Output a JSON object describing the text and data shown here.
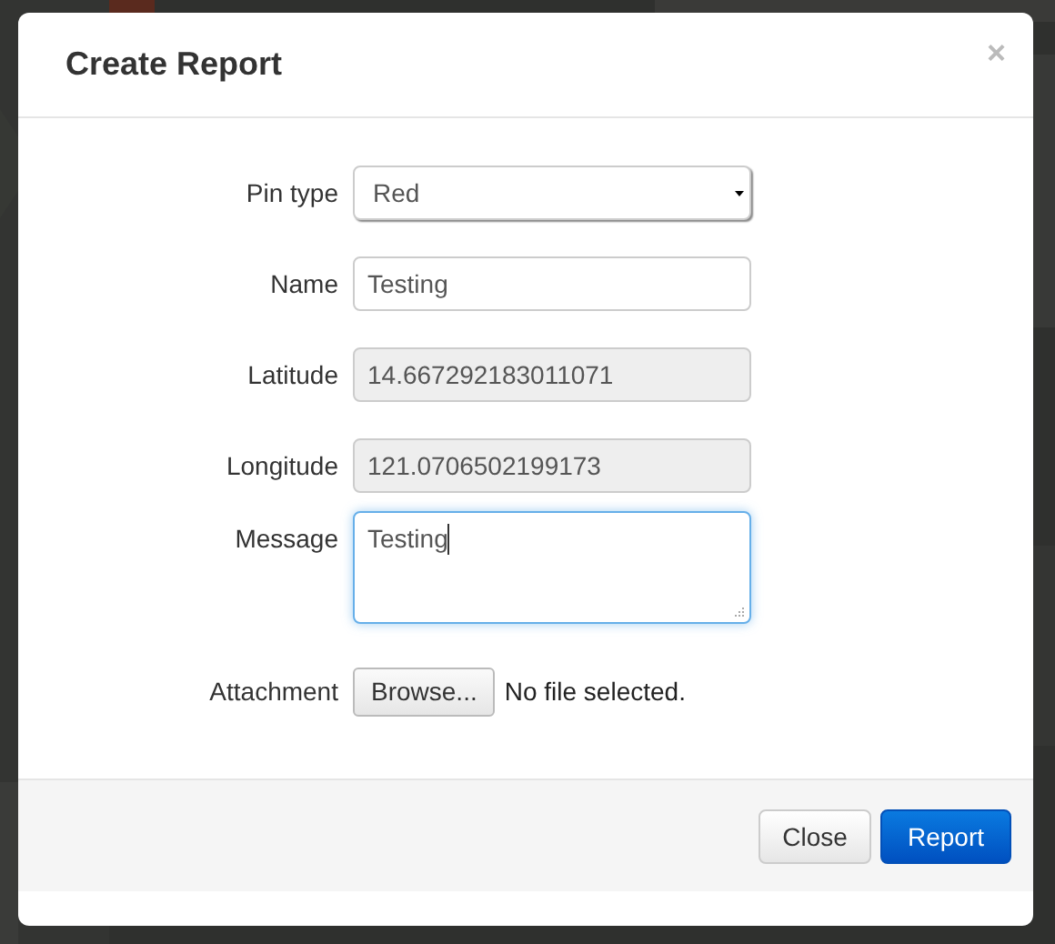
{
  "dialog": {
    "title": "Create Report",
    "close": "×"
  },
  "fields": [
    {
      "kind": "select",
      "label": "Pin type",
      "value": "Red",
      "focused": false
    },
    {
      "kind": "text",
      "label": "Name",
      "value": "Testing",
      "focused": false
    },
    {
      "kind": "readonly",
      "label": "Latitude",
      "value": "14.667292183011071",
      "focused": false
    },
    {
      "kind": "readonly",
      "label": "Longitude",
      "value": "121.0706502199173",
      "focused": false
    },
    {
      "kind": "textarea",
      "label": "Message",
      "value": "Testing",
      "focused": true
    },
    {
      "kind": "file",
      "label": "Attachment",
      "button": "Browse...",
      "status": "No file selected."
    }
  ],
  "buttons": [
    {
      "kind": "default",
      "label": "Close"
    },
    {
      "kind": "primary",
      "label": "Report"
    }
  ]
}
